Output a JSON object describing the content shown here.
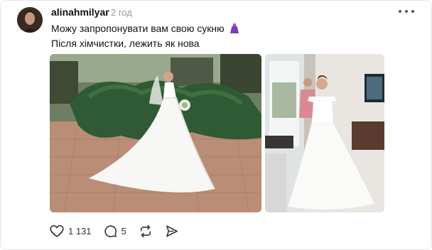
{
  "post": {
    "username": "alinahmilyar",
    "time_ago": "2 год",
    "text_line1": "Можу запропонувати вам свою сукню",
    "text_line2": "Після хімчистки, лежить як нова",
    "images": [
      {
        "icon": "wedding-photo-outdoor"
      },
      {
        "icon": "wedding-photo-indoor"
      }
    ]
  },
  "actions": {
    "like_count": "1 131",
    "reply_count": "5"
  },
  "colors": {
    "text": "#111111",
    "muted": "#999999",
    "icon": "#333333"
  }
}
